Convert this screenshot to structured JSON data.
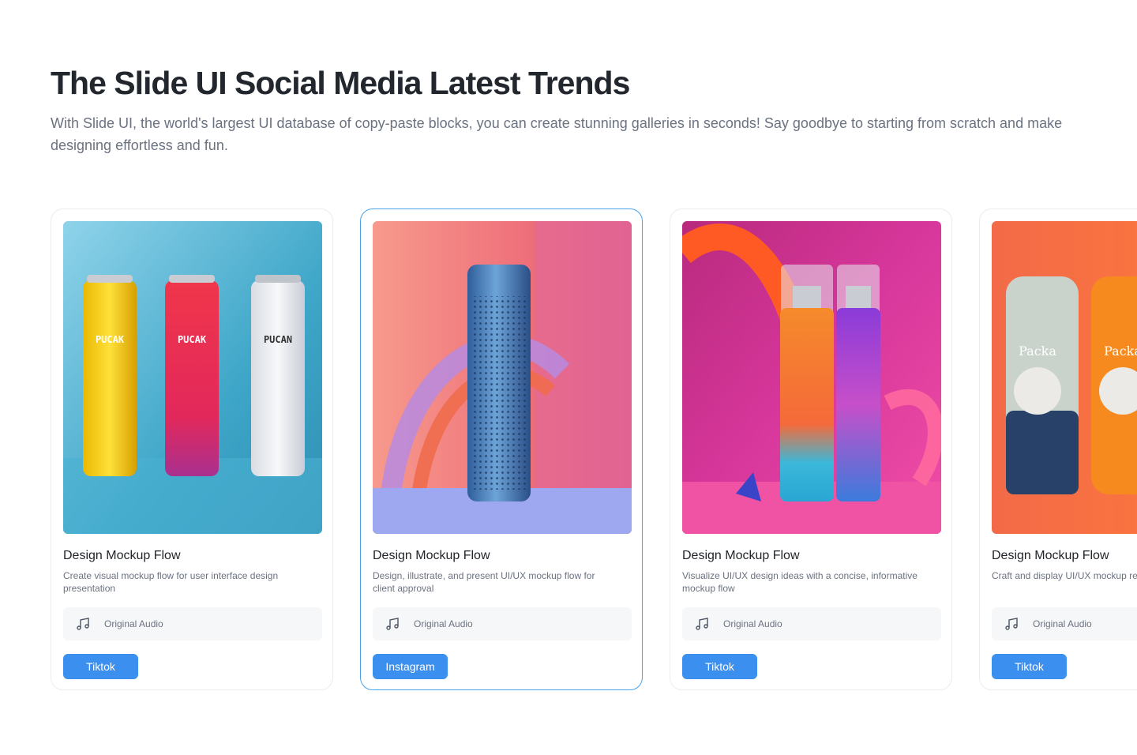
{
  "header": {
    "title": "The Slide UI Social Media Latest Trends",
    "subtitle": "With Slide UI, the world's largest UI database of copy-paste blocks, you can create stunning galleries in seconds! Say goodbye to starting from scratch and make designing effortless and fun."
  },
  "accent_color": "#3b8fef",
  "active_border_color": "#4aa3e8",
  "cards": [
    {
      "title": "Design Mockup Flow",
      "description": "Create visual mockup flow for user interface design presentation",
      "audio_label": "Original Audio",
      "platform": "Tiktok",
      "image_labels": [
        "PUCAK",
        "PUCAK",
        "PUCAN"
      ]
    },
    {
      "title": "Design Mockup Flow",
      "description": "Design, illustrate, and present UI/UX mockup flow for client approval",
      "audio_label": "Original Audio",
      "platform": "Instagram"
    },
    {
      "title": "Design Mockup Flow",
      "description": "Visualize UI/UX design ideas with a concise, informative mockup flow",
      "audio_label": "Original Audio",
      "platform": "Tiktok"
    },
    {
      "title": "Design Mockup Flow",
      "description": "Craft and display UI/UX mockup review",
      "audio_label": "Original Audio",
      "platform": "Tiktok",
      "image_labels": [
        "Packa",
        "Packa"
      ]
    }
  ]
}
